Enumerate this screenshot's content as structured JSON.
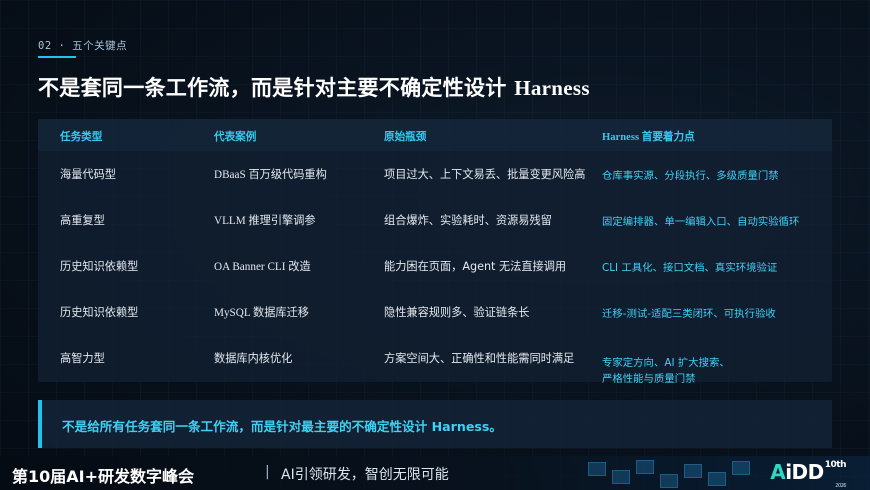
{
  "section": {
    "number": "02",
    "dot": "·",
    "label": "五个关键点"
  },
  "title": {
    "cn": "不是套同一条工作流，而是针对主要不确定性设计",
    "latin": "Harness"
  },
  "table": {
    "headers": [
      "任务类型",
      "代表案例",
      "原始瓶颈",
      "Harness 首要着力点"
    ],
    "rows": [
      {
        "type": "海量代码型",
        "case": "DBaaS 百万级代码重构",
        "bottleneck": "项目过大、上下文易丢、批量变更风险高",
        "focus": "仓库事实源、分段执行、多级质量门禁",
        "focus2": ""
      },
      {
        "type": "高重复型",
        "case": "VLLM 推理引擎调参",
        "bottleneck": "组合爆炸、实验耗时、资源易残留",
        "focus": "固定编排器、单一编辑入口、自动实验循环",
        "focus2": ""
      },
      {
        "type": "历史知识依赖型",
        "case": "OA Banner CLI 改造",
        "bottleneck": "能力困在页面，Agent 无法直接调用",
        "focus": "CLI 工具化、接口文档、真实环境验证",
        "focus2": ""
      },
      {
        "type": "历史知识依赖型",
        "case": "MySQL 数据库迁移",
        "bottleneck": "隐性兼容规则多、验证链条长",
        "focus": "迁移-测试-适配三类闭环、可执行验收",
        "focus2": ""
      },
      {
        "type": "高智力型",
        "case": "数据库内核优化",
        "bottleneck": "方案空间大、正确性和性能需同时满足",
        "focus": "专家定方向、AI 扩大搜索、",
        "focus2": "严格性能与质量门禁"
      }
    ]
  },
  "callout": {
    "text": "不是给所有任务套同一条工作流，而是针对最主要的不确定性设计 Harness。"
  },
  "footer": {
    "event": "第10届AI+研发数字峰会",
    "separator": "|",
    "tagline": "AI引领研发，智创无限可能",
    "logo": {
      "text_a": "A",
      "text_rest": "iDD",
      "sup": "10th",
      "year": "2026"
    }
  },
  "colors": {
    "accent": "#22c3ea",
    "background": "#08111c",
    "text": "#ffffff"
  }
}
